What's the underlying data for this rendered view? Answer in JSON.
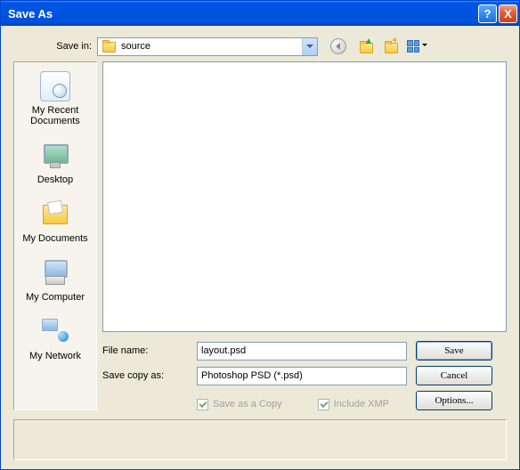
{
  "titlebar": {
    "title": "Save As",
    "help_symbol": "?",
    "close_symbol": "X"
  },
  "savein": {
    "label": "Save in:",
    "value": "source"
  },
  "places": [
    {
      "label": "My Recent Documents"
    },
    {
      "label": "Desktop"
    },
    {
      "label": "My Documents"
    },
    {
      "label": "My Computer"
    },
    {
      "label": "My Network"
    }
  ],
  "fields": {
    "filename_label": "File name:",
    "filename_value": "layout.psd",
    "format_label": "Save copy as:",
    "format_value": "Photoshop PSD (*.psd)"
  },
  "buttons": {
    "save": "Save",
    "cancel": "Cancel",
    "options": "Options..."
  },
  "checks": {
    "save_copy": "Save as a Copy",
    "include_xmp": "Include XMP"
  }
}
